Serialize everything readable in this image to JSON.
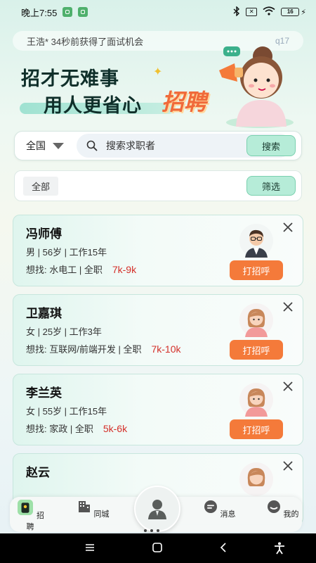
{
  "status_bar": {
    "time": "晚上7:55",
    "battery_level": "16"
  },
  "ticker": {
    "text": "王浩* 34秒前获得了面试机会",
    "counter": "q17"
  },
  "banner": {
    "line1": "招才无难事",
    "line2": "用人更省心",
    "logo": "招聘"
  },
  "search": {
    "region": "全国",
    "placeholder": "搜索求职者",
    "button": "搜索"
  },
  "filter": {
    "chip": "全部",
    "button": "筛选"
  },
  "candidates": [
    {
      "name": "冯师傅",
      "info": "男 | 56岁 | 工作15年",
      "want_label": "想找:",
      "want": "水电工 | 全职",
      "salary": "7k-9k",
      "greet": "打招呼",
      "avatar": "male-avatar"
    },
    {
      "name": "卫嘉琪",
      "info": "女 | 25岁 | 工作3年",
      "want_label": "想找:",
      "want": "互联网/前端开发 | 全职",
      "salary": "7k-10k",
      "greet": "打招呼",
      "avatar": "female-avatar"
    },
    {
      "name": "李兰英",
      "info": "女 | 55岁 | 工作15年",
      "want_label": "想找:",
      "want": "家政 | 全职",
      "salary": "5k-6k",
      "greet": "打招呼",
      "avatar": "female-avatar"
    },
    {
      "name": "赵云",
      "info": "",
      "want_label": "",
      "want": "",
      "salary": "",
      "greet": "",
      "avatar": "female-avatar"
    }
  ],
  "bottom_nav": [
    {
      "label": "招聘",
      "icon": "recruit-icon",
      "active": true
    },
    {
      "label": "同城",
      "icon": "city-icon"
    },
    {
      "label": "消息",
      "icon": "message-icon"
    },
    {
      "label": "我的",
      "icon": "profile-icon"
    }
  ],
  "colors": {
    "accent": "#f47a3a",
    "salary": "#d4302a",
    "brand_green": "#7ad0ae"
  }
}
